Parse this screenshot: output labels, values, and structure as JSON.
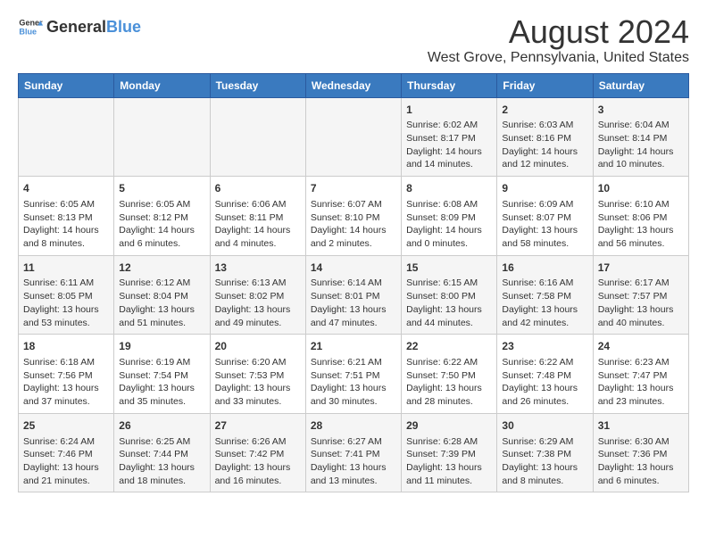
{
  "logo": {
    "general": "General",
    "blue": "Blue"
  },
  "title": "August 2024",
  "subtitle": "West Grove, Pennsylvania, United States",
  "days_of_week": [
    "Sunday",
    "Monday",
    "Tuesday",
    "Wednesday",
    "Thursday",
    "Friday",
    "Saturday"
  ],
  "weeks": [
    [
      {
        "day": "",
        "info": ""
      },
      {
        "day": "",
        "info": ""
      },
      {
        "day": "",
        "info": ""
      },
      {
        "day": "",
        "info": ""
      },
      {
        "day": "1",
        "info": "Sunrise: 6:02 AM\nSunset: 8:17 PM\nDaylight: 14 hours and 14 minutes."
      },
      {
        "day": "2",
        "info": "Sunrise: 6:03 AM\nSunset: 8:16 PM\nDaylight: 14 hours and 12 minutes."
      },
      {
        "day": "3",
        "info": "Sunrise: 6:04 AM\nSunset: 8:14 PM\nDaylight: 14 hours and 10 minutes."
      }
    ],
    [
      {
        "day": "4",
        "info": "Sunrise: 6:05 AM\nSunset: 8:13 PM\nDaylight: 14 hours and 8 minutes."
      },
      {
        "day": "5",
        "info": "Sunrise: 6:05 AM\nSunset: 8:12 PM\nDaylight: 14 hours and 6 minutes."
      },
      {
        "day": "6",
        "info": "Sunrise: 6:06 AM\nSunset: 8:11 PM\nDaylight: 14 hours and 4 minutes."
      },
      {
        "day": "7",
        "info": "Sunrise: 6:07 AM\nSunset: 8:10 PM\nDaylight: 14 hours and 2 minutes."
      },
      {
        "day": "8",
        "info": "Sunrise: 6:08 AM\nSunset: 8:09 PM\nDaylight: 14 hours and 0 minutes."
      },
      {
        "day": "9",
        "info": "Sunrise: 6:09 AM\nSunset: 8:07 PM\nDaylight: 13 hours and 58 minutes."
      },
      {
        "day": "10",
        "info": "Sunrise: 6:10 AM\nSunset: 8:06 PM\nDaylight: 13 hours and 56 minutes."
      }
    ],
    [
      {
        "day": "11",
        "info": "Sunrise: 6:11 AM\nSunset: 8:05 PM\nDaylight: 13 hours and 53 minutes."
      },
      {
        "day": "12",
        "info": "Sunrise: 6:12 AM\nSunset: 8:04 PM\nDaylight: 13 hours and 51 minutes."
      },
      {
        "day": "13",
        "info": "Sunrise: 6:13 AM\nSunset: 8:02 PM\nDaylight: 13 hours and 49 minutes."
      },
      {
        "day": "14",
        "info": "Sunrise: 6:14 AM\nSunset: 8:01 PM\nDaylight: 13 hours and 47 minutes."
      },
      {
        "day": "15",
        "info": "Sunrise: 6:15 AM\nSunset: 8:00 PM\nDaylight: 13 hours and 44 minutes."
      },
      {
        "day": "16",
        "info": "Sunrise: 6:16 AM\nSunset: 7:58 PM\nDaylight: 13 hours and 42 minutes."
      },
      {
        "day": "17",
        "info": "Sunrise: 6:17 AM\nSunset: 7:57 PM\nDaylight: 13 hours and 40 minutes."
      }
    ],
    [
      {
        "day": "18",
        "info": "Sunrise: 6:18 AM\nSunset: 7:56 PM\nDaylight: 13 hours and 37 minutes."
      },
      {
        "day": "19",
        "info": "Sunrise: 6:19 AM\nSunset: 7:54 PM\nDaylight: 13 hours and 35 minutes."
      },
      {
        "day": "20",
        "info": "Sunrise: 6:20 AM\nSunset: 7:53 PM\nDaylight: 13 hours and 33 minutes."
      },
      {
        "day": "21",
        "info": "Sunrise: 6:21 AM\nSunset: 7:51 PM\nDaylight: 13 hours and 30 minutes."
      },
      {
        "day": "22",
        "info": "Sunrise: 6:22 AM\nSunset: 7:50 PM\nDaylight: 13 hours and 28 minutes."
      },
      {
        "day": "23",
        "info": "Sunrise: 6:22 AM\nSunset: 7:48 PM\nDaylight: 13 hours and 26 minutes."
      },
      {
        "day": "24",
        "info": "Sunrise: 6:23 AM\nSunset: 7:47 PM\nDaylight: 13 hours and 23 minutes."
      }
    ],
    [
      {
        "day": "25",
        "info": "Sunrise: 6:24 AM\nSunset: 7:46 PM\nDaylight: 13 hours and 21 minutes."
      },
      {
        "day": "26",
        "info": "Sunrise: 6:25 AM\nSunset: 7:44 PM\nDaylight: 13 hours and 18 minutes."
      },
      {
        "day": "27",
        "info": "Sunrise: 6:26 AM\nSunset: 7:42 PM\nDaylight: 13 hours and 16 minutes."
      },
      {
        "day": "28",
        "info": "Sunrise: 6:27 AM\nSunset: 7:41 PM\nDaylight: 13 hours and 13 minutes."
      },
      {
        "day": "29",
        "info": "Sunrise: 6:28 AM\nSunset: 7:39 PM\nDaylight: 13 hours and 11 minutes."
      },
      {
        "day": "30",
        "info": "Sunrise: 6:29 AM\nSunset: 7:38 PM\nDaylight: 13 hours and 8 minutes."
      },
      {
        "day": "31",
        "info": "Sunrise: 6:30 AM\nSunset: 7:36 PM\nDaylight: 13 hours and 6 minutes."
      }
    ]
  ]
}
